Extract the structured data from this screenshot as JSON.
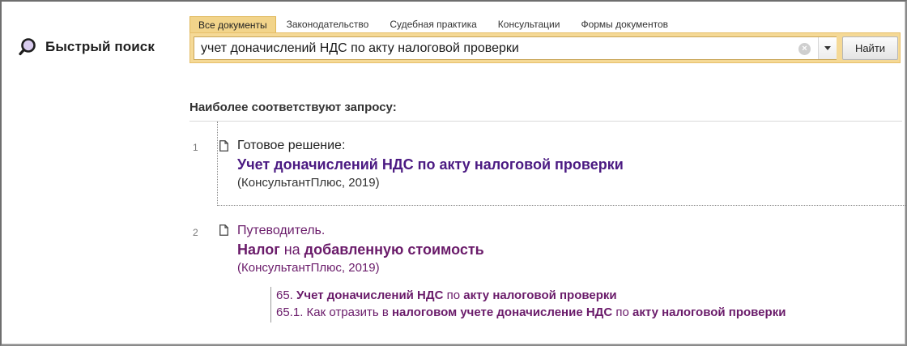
{
  "quick_search": {
    "label": "Быстрый поиск",
    "icon": "search-icon"
  },
  "tabs": [
    {
      "label": "Все документы",
      "active": true
    },
    {
      "label": "Законодательство",
      "active": false
    },
    {
      "label": "Судебная практика",
      "active": false
    },
    {
      "label": "Консультации",
      "active": false
    },
    {
      "label": "Формы документов",
      "active": false
    }
  ],
  "search": {
    "value": "учет доначислений НДС по акту налоговой проверки",
    "clear_icon": "×",
    "find_label": "Найти"
  },
  "results_heading": "Наиболее соответствуют запросу:",
  "results": [
    {
      "number": "1",
      "type": "Готовое решение:",
      "title": "Учет доначислений НДС по акту налоговой проверки",
      "source": "(КонсультантПлюс, 2019)"
    },
    {
      "number": "2",
      "type": "Путеводитель.",
      "title_parts": {
        "p1": "Налог",
        "p2": " на ",
        "p3": "добавленную стоимость"
      },
      "source": "(КонсультантПлюс, 2019)",
      "sub_items": [
        {
          "p1": "65. ",
          "p2": "Учет доначислений НДС",
          "p3": " по ",
          "p4": "акту налоговой проверки"
        },
        {
          "p1": "65.1. Как отразить в ",
          "p2": "налоговом учете доначисление НДС",
          "p3": " по ",
          "p4": "акту налоговой проверки"
        }
      ]
    }
  ],
  "colors": {
    "tab_active_bg": "#f2d48a",
    "search_panel_bg": "#f5d996",
    "result_title_color": "#4b1a82",
    "visited_color": "#6a1b6a"
  }
}
